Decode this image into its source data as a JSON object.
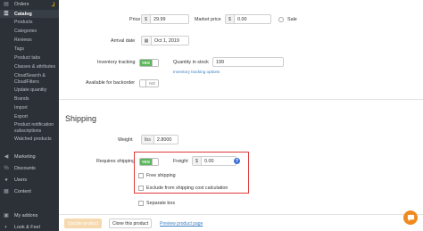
{
  "sidebar": {
    "items_top": [
      {
        "label": "Orders",
        "icon": "orders-icon"
      },
      {
        "label": "Catalog",
        "icon": "catalog-icon",
        "active": true
      }
    ],
    "catalog_sub": [
      "Products",
      "Categories",
      "Reviews",
      "Tags",
      "Product tabs",
      "Classes & attributes",
      "CloudSearch & CloudFilters",
      "Update quantity",
      "Brands",
      "Import",
      "Export",
      "Product notification subscriptions",
      "Watched products"
    ],
    "items_bottom": [
      {
        "label": "Marketing",
        "icon": "megaphone-icon"
      },
      {
        "label": "Discounts",
        "icon": "discount-icon"
      },
      {
        "label": "Users",
        "icon": "users-icon"
      },
      {
        "label": "Content",
        "icon": "content-icon"
      },
      {
        "label": "My addons",
        "icon": "addons-icon"
      },
      {
        "label": "Look & Feel",
        "icon": "palette-icon"
      }
    ]
  },
  "pricing": {
    "price_label": "Price",
    "price_currency": "$",
    "price_value": "29.99",
    "market_label": "Market price",
    "market_currency": "$",
    "market_value": "0.00",
    "sale_label": "Sale"
  },
  "arrival": {
    "label": "Arrival date",
    "value": "Oct 1, 2019"
  },
  "inventory": {
    "label": "Inventory tracking",
    "toggle": "YES",
    "qty_label": "Quantity in stock",
    "qty_value": "199",
    "options_link": "Inventory tracking options"
  },
  "backorder": {
    "label": "Available for backorder",
    "toggle": "NO"
  },
  "shipping": {
    "title": "Shipping",
    "weight_label": "Weight",
    "weight_unit": "lbs",
    "weight_value": "2.8000",
    "requires_label": "Requires shipping",
    "requires_toggle": "YES",
    "freight_label": "Freight",
    "freight_currency": "$",
    "freight_value": "0.00",
    "free_shipping_label": "Free shipping",
    "exclude_label": "Exclude from shipping cost calculation",
    "separate_label": "Separate box"
  },
  "footer": {
    "update_label": "Update product",
    "clone_label": "Clone this product",
    "preview_label": "Preview product page"
  }
}
